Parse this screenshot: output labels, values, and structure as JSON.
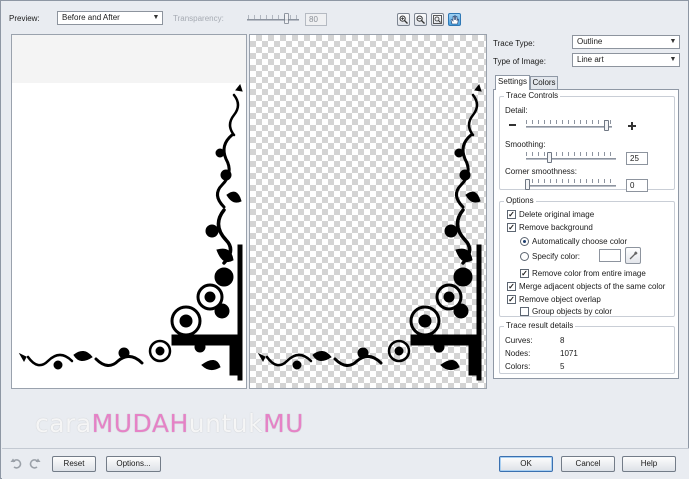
{
  "toolbar": {
    "preview_label": "Preview:",
    "preview_value": "Before and After",
    "transparency_label": "Transparency:",
    "transparency_value": "80"
  },
  "trace": {
    "type_label": "Trace Type:",
    "type_value": "Outline",
    "image_label": "Type of Image:",
    "image_value": "Line art"
  },
  "tabs": {
    "settings": "Settings",
    "colors": "Colors"
  },
  "controls": {
    "title": "Trace Controls",
    "detail_label": "Detail:",
    "smoothing_label": "Smoothing:",
    "smoothing_value": "25",
    "corner_label": "Corner smoothness:",
    "corner_value": "0"
  },
  "options": {
    "title": "Options",
    "delete_original": "Delete original image",
    "remove_background": "Remove background",
    "auto_color": "Automatically choose color",
    "specify_color": "Specify color:",
    "remove_entire": "Remove color from entire image",
    "merge_adjacent": "Merge adjacent objects of the same color",
    "remove_overlap": "Remove object overlap",
    "group_by_color": "Group objects by color"
  },
  "details": {
    "title": "Trace result details",
    "curves_label": "Curves:",
    "curves_value": "8",
    "nodes_label": "Nodes:",
    "nodes_value": "1071",
    "colors_label": "Colors:",
    "colors_value": "5"
  },
  "watermark": {
    "part1": "cara",
    "part2": "MUDAH",
    "part3": "untuk",
    "part4": "MU"
  },
  "buttons": {
    "reset": "Reset",
    "options": "Options...",
    "ok": "OK",
    "cancel": "Cancel",
    "help": "Help"
  },
  "icons": {
    "zoom_in": "zoom-in-icon",
    "zoom_out": "zoom-out-icon",
    "fit": "zoom-fit-icon",
    "pan": "pan-hand-icon",
    "undo": "undo-icon",
    "redo": "redo-icon"
  }
}
